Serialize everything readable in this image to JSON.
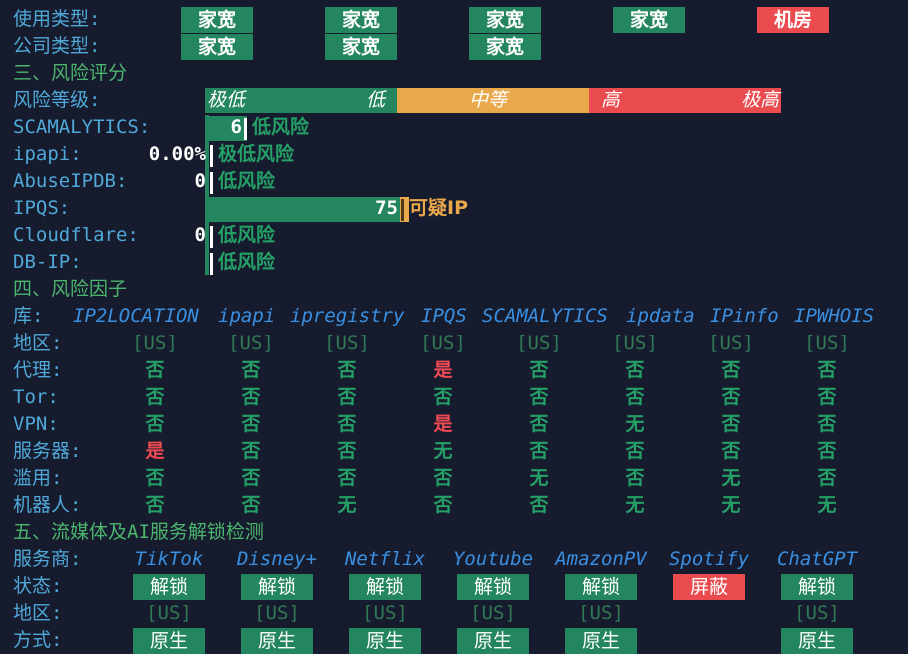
{
  "usage": {
    "label": "使用类型:",
    "tags": [
      {
        "text": "家宽",
        "color": "green"
      },
      {
        "text": "家宽",
        "color": "green"
      },
      {
        "text": "家宽",
        "color": "green"
      },
      {
        "text": "家宽",
        "color": "green"
      },
      {
        "text": "机房",
        "color": "red"
      }
    ]
  },
  "company": {
    "label": "公司类型:",
    "tags": [
      {
        "text": "家宽",
        "color": "green"
      },
      {
        "text": "家宽",
        "color": "green"
      },
      {
        "text": "家宽",
        "color": "green"
      }
    ]
  },
  "section3": "三、风险评分",
  "risk_level": {
    "label": "风险等级:",
    "scale": [
      "极低",
      "低",
      "中等",
      "高",
      "极高"
    ]
  },
  "scores": [
    {
      "label": "SCAMALYTICS:",
      "value": "6",
      "risk": "低风险",
      "fraction": 0.06
    },
    {
      "label": "ipapi:",
      "value": "0.00%",
      "risk": "极低风险",
      "fraction": 0
    },
    {
      "label": "AbuseIPDB:",
      "value": "0",
      "risk": "低风险",
      "fraction": 0
    },
    {
      "label": "IPQS:",
      "value": "75",
      "risk": "可疑IP",
      "fraction": 0.75
    },
    {
      "label": "Cloudflare:",
      "value": "0",
      "risk": "低风险",
      "fraction": 0
    },
    {
      "label": "DB-IP:",
      "value": "",
      "risk": "低风险",
      "fraction": 0
    }
  ],
  "section4": "四、风险因子",
  "factors": {
    "lib_label": "库:",
    "libs": [
      "IP2LOCATION",
      "ipapi",
      "ipregistry",
      "IPQS",
      "SCAMALYTICS",
      "ipdata",
      "IPinfo",
      "IPWHOIS"
    ],
    "rows": [
      {
        "label": "地区:",
        "values": [
          "[US]",
          "[US]",
          "[US]",
          "[US]",
          "[US]",
          "[US]",
          "[US]",
          "[US]"
        ]
      },
      {
        "label": "代理:",
        "values": [
          "否",
          "否",
          "否",
          "是",
          "否",
          "否",
          "否",
          "否"
        ]
      },
      {
        "label": "Tor:",
        "values": [
          "否",
          "否",
          "否",
          "否",
          "否",
          "否",
          "否",
          "否"
        ]
      },
      {
        "label": "VPN:",
        "values": [
          "否",
          "否",
          "否",
          "是",
          "否",
          "无",
          "否",
          "否"
        ]
      },
      {
        "label": "服务器:",
        "values": [
          "是",
          "否",
          "否",
          "无",
          "否",
          "否",
          "否",
          "否"
        ]
      },
      {
        "label": "滥用:",
        "values": [
          "否",
          "否",
          "否",
          "否",
          "无",
          "否",
          "无",
          "否"
        ]
      },
      {
        "label": "机器人:",
        "values": [
          "否",
          "否",
          "无",
          "否",
          "否",
          "无",
          "无",
          "无"
        ]
      }
    ]
  },
  "section5": "五、流媒体及AI服务解锁检测",
  "streaming": {
    "provider_label": "服务商:",
    "providers": [
      "TikTok",
      "Disney+",
      "Netflix",
      "Youtube",
      "AmazonPV",
      "Spotify",
      "ChatGPT"
    ],
    "status_label": "状态:",
    "status": [
      {
        "text": "解锁",
        "color": "green"
      },
      {
        "text": "解锁",
        "color": "green"
      },
      {
        "text": "解锁",
        "color": "green"
      },
      {
        "text": "解锁",
        "color": "green"
      },
      {
        "text": "解锁",
        "color": "green"
      },
      {
        "text": "屏蔽",
        "color": "red"
      },
      {
        "text": "解锁",
        "color": "green"
      }
    ],
    "region_label": "地区:",
    "regions": [
      "[US]",
      "[US]",
      "[US]",
      "[US]",
      "[US]",
      "",
      "[US]"
    ],
    "method_label": "方式:",
    "methods": [
      "原生",
      "原生",
      "原生",
      "原生",
      "原生",
      "",
      "原生"
    ]
  },
  "colors": {
    "background": "#161b2e",
    "green": "#24865e",
    "orange": "#e9a84a",
    "red": "#e94b4f",
    "label_blue": "#4fa8d8",
    "section_green": "#4cb56e"
  }
}
